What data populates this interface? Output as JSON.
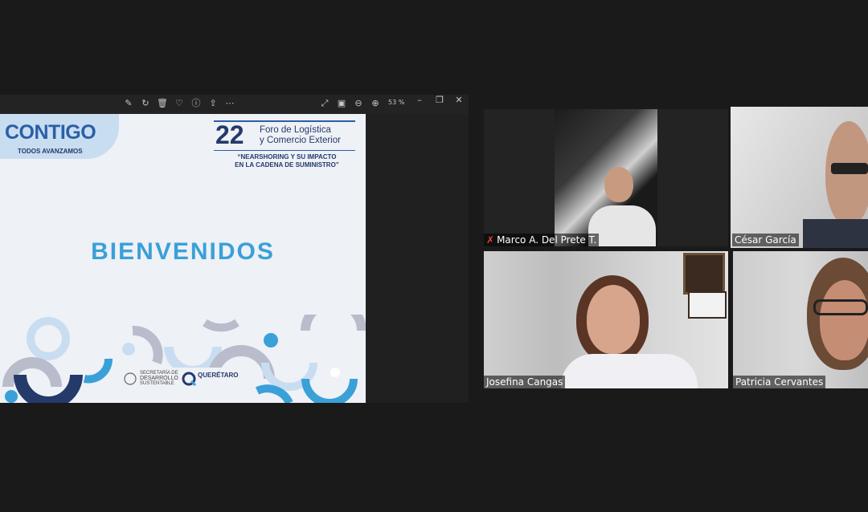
{
  "toolbar": {
    "zoom": "53 %",
    "icons": [
      "edit-icon",
      "rotate-icon",
      "delete-icon",
      "favorite-icon",
      "info-icon",
      "share-icon",
      "more-icon",
      "fullscreen-icon",
      "compare-icon",
      "zoom-out-icon",
      "zoom-in-icon"
    ],
    "window_controls": [
      "minimize",
      "restore",
      "close"
    ]
  },
  "slide": {
    "brand": "CONTIGO",
    "brand_tagline": "TODOS AVANZAMOS",
    "event_number": "22",
    "event_title_line1": "Foro de Logística",
    "event_title_line2": "y Comercio Exterior",
    "event_subtitle_line1": "“NEARSHORING Y SU IMPACTO",
    "event_subtitle_line2": "EN LA CADENA DE SUMINISTRO”",
    "welcome": "BIENVENIDOS",
    "logo1_line1": "SECRETARÍA DE",
    "logo1_line2": "DESARROLLO",
    "logo1_line3": "SUSTENTABLE",
    "logo2": "QUERÉTARO",
    "colors": {
      "dark_blue": "#243a6b",
      "light_blue": "#3aa0d8",
      "badge": "#c9ddf1",
      "gray": "#b9bccb"
    }
  },
  "participants": [
    {
      "name": "Marco A. Del Prete T.",
      "muted": true
    },
    {
      "name": "César García",
      "muted": false,
      "active_speaker": true
    },
    {
      "name": "Josefina Cangas",
      "muted": false
    },
    {
      "name": "Patricia Cervantes",
      "muted": false
    }
  ],
  "accent_color": "#b8e03a"
}
